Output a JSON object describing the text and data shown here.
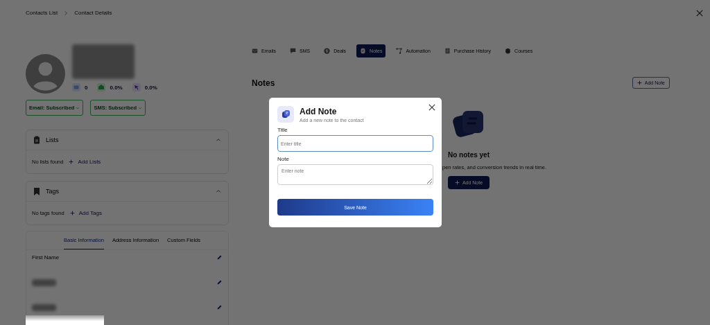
{
  "breadcrumb": [
    "Contacts List",
    "Contact Details"
  ],
  "contact": {
    "stats": [
      {
        "kind": "email",
        "value": "0"
      },
      {
        "kind": "open",
        "value": "0.0%"
      },
      {
        "kind": "click",
        "value": "0.0%"
      }
    ],
    "subscriptions": [
      "Email: Subscribed",
      "SMS: Subscribed"
    ]
  },
  "sections": [
    {
      "kind": "lists",
      "title": "Lists",
      "expanded": true,
      "empty": "No lists found",
      "action": "Add Lists"
    },
    {
      "kind": "tags",
      "title": "Tags",
      "expanded": true,
      "empty": "No tags found",
      "action": "Add Tags"
    }
  ],
  "info_tabs": [
    {
      "label": "Basic Information",
      "selected": true
    },
    {
      "label": "Address Information",
      "selected": false
    },
    {
      "label": "Custom Fields",
      "selected": false
    }
  ],
  "info_fields": [
    {
      "label": "First Name",
      "redacted": false
    },
    {
      "redacted": true
    },
    {
      "redacted": true
    }
  ],
  "tabs": [
    {
      "kind": "email",
      "label": "Emails",
      "selected": false
    },
    {
      "kind": "sms",
      "label": "SMS",
      "selected": false
    },
    {
      "kind": "deals",
      "label": "Deals",
      "selected": false
    },
    {
      "kind": "notes",
      "label": "Notes",
      "selected": true
    },
    {
      "kind": "automation",
      "label": "Automation",
      "selected": false
    },
    {
      "kind": "purchase",
      "label": "Purchase History",
      "selected": false
    },
    {
      "kind": "courses",
      "label": "Courses",
      "selected": false
    }
  ],
  "notes": {
    "heading": "Notes",
    "add_button": "Add Note",
    "empty_title": "No notes yet",
    "empty_text": "pen rates, and conversion trends in real time.",
    "empty_button": "Add Note"
  },
  "modal": {
    "title": "Add Note",
    "subtitle": "Add a new note to the contact",
    "fields": [
      {
        "kind": "input",
        "label": "Title",
        "placeholder": "Enter title",
        "focused": true
      },
      {
        "kind": "textarea",
        "label": "Note",
        "placeholder": "Enter note",
        "focused": false
      }
    ],
    "submit": "Save Note"
  }
}
